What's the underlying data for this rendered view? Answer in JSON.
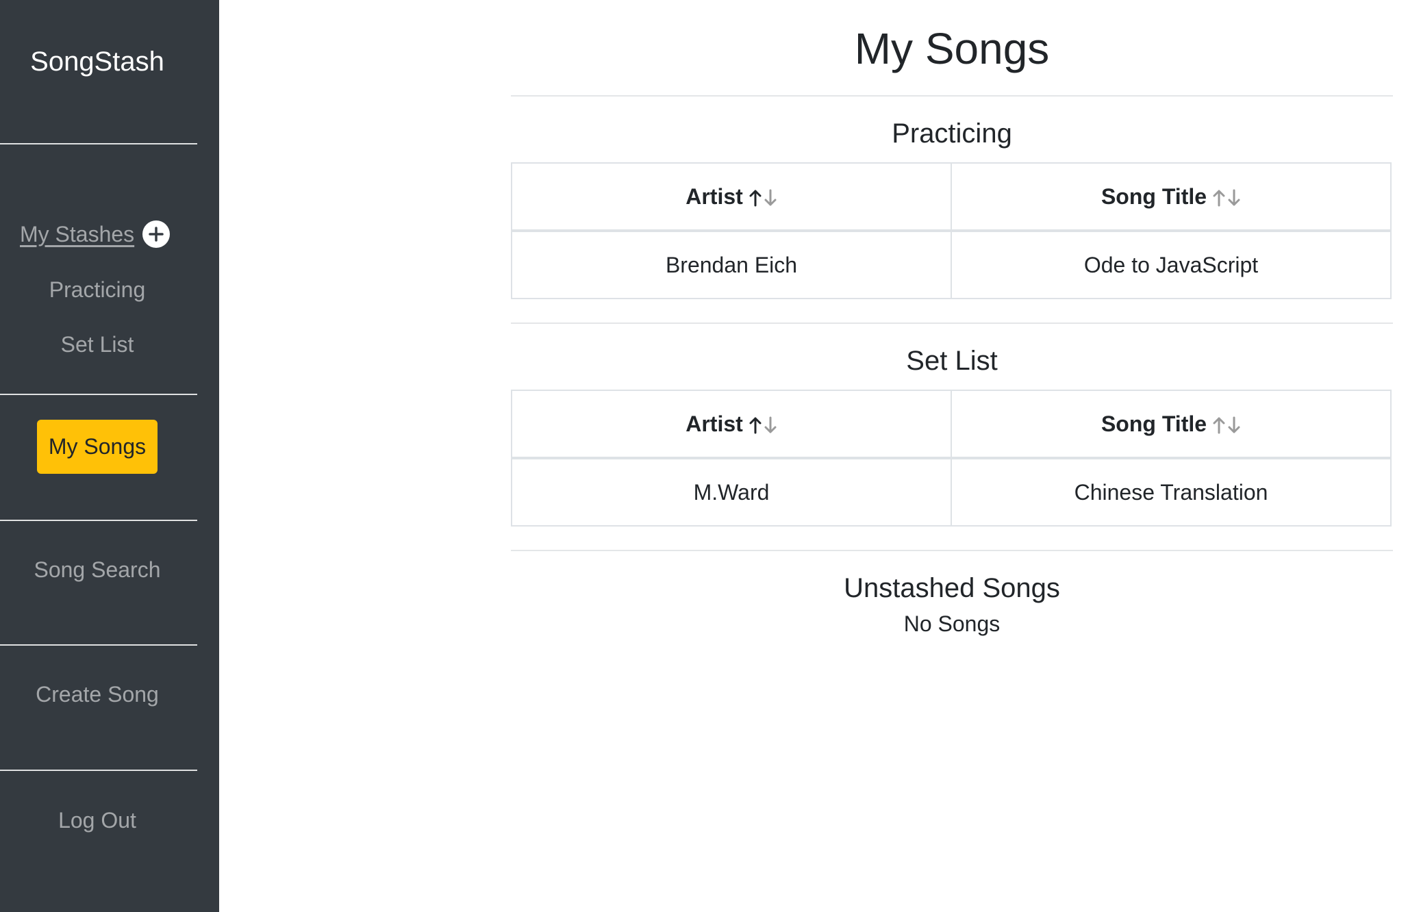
{
  "sidebar": {
    "brand": "SongStash",
    "stashes_label": "My Stashes",
    "stash_items": [
      "Practicing",
      "Set List"
    ],
    "my_songs": "My Songs",
    "song_search": "Song Search",
    "create_song": "Create Song",
    "log_out": "Log Out"
  },
  "main": {
    "title": "My Songs",
    "sections": [
      {
        "title": "Practicing",
        "headers": [
          "Artist",
          "Song Title"
        ],
        "rows": [
          [
            "Brendan Eich",
            "Ode to JavaScript"
          ]
        ]
      },
      {
        "title": "Set List",
        "headers": [
          "Artist",
          "Song Title"
        ],
        "rows": [
          [
            "M.Ward",
            "Chinese Translation"
          ]
        ]
      }
    ],
    "unstashed": {
      "title": "Unstashed Songs",
      "empty": "No Songs"
    }
  },
  "colors": {
    "sidebar_bg": "#343a40",
    "accent": "#ffc107"
  }
}
